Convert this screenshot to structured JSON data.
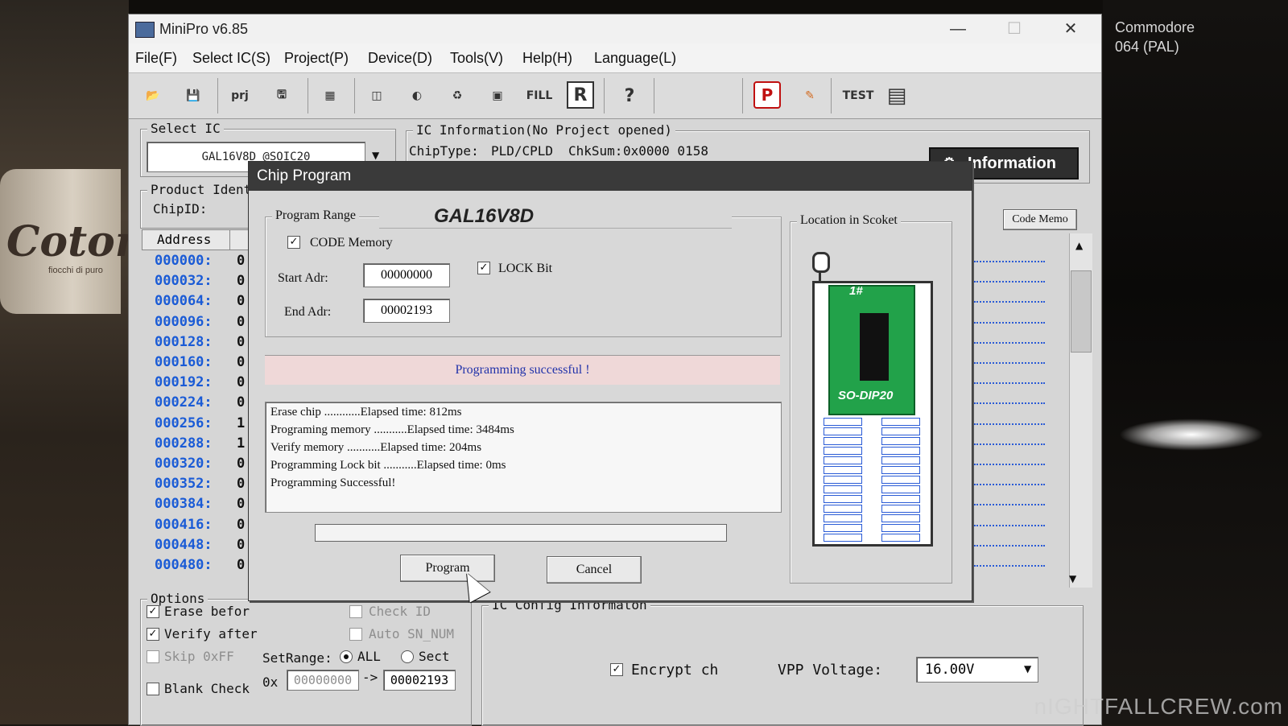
{
  "background": {
    "right_text_line1": "Commodore",
    "right_text_line2": "064 (PAL)",
    "cup_brand": "Cotone",
    "cup_sub": "fiocchi di puro",
    "watermark": "nIGHTFALLCREW.com"
  },
  "app": {
    "title": "MiniPro v6.85",
    "window_controls": [
      "—",
      "☐",
      "✕"
    ]
  },
  "menu": [
    "File(F)",
    "Select IC(S)",
    "Project(P)",
    "Device(D)",
    "Tools(V)",
    "Help(H)",
    "Language(L)"
  ],
  "toolbar": {
    "prj_label": "prj",
    "fill_label": "FILL",
    "r_label": "R",
    "help_label": "?",
    "p_label": "P",
    "test_label": "TEST"
  },
  "select_ic": {
    "label": "Select IC",
    "value": "GAL16V8D @SOIC20"
  },
  "ic_info": {
    "label": "IC Information(No Project opened)",
    "chip_type_label": "ChipType:",
    "chip_type": "PLD/CPLD",
    "checksum_label": "ChkSum:",
    "checksum": "0x0000 0158",
    "information_button": "Information"
  },
  "product_ident": {
    "label": "Product Identi",
    "chipid_label": "ChipID:"
  },
  "code_memo_tab": "Code Memo",
  "address_table": {
    "header": "Address",
    "rows": [
      {
        "addr": "000000:",
        "val": "0"
      },
      {
        "addr": "000032:",
        "val": "0"
      },
      {
        "addr": "000064:",
        "val": "0"
      },
      {
        "addr": "000096:",
        "val": "0"
      },
      {
        "addr": "000128:",
        "val": "0"
      },
      {
        "addr": "000160:",
        "val": "0"
      },
      {
        "addr": "000192:",
        "val": "0"
      },
      {
        "addr": "000224:",
        "val": "0"
      },
      {
        "addr": "000256:",
        "val": "1"
      },
      {
        "addr": "000288:",
        "val": "1"
      },
      {
        "addr": "000320:",
        "val": "0"
      },
      {
        "addr": "000352:",
        "val": "0"
      },
      {
        "addr": "000384:",
        "val": "0"
      },
      {
        "addr": "000416:",
        "val": "0"
      },
      {
        "addr": "000448:",
        "val": "0"
      },
      {
        "addr": "000480:",
        "val": "0"
      }
    ]
  },
  "options": {
    "label": "Options",
    "erase_before": "Erase befor",
    "verify_after": "Verify after",
    "skip_0xff": "Skip 0xFF",
    "blank_check": "Blank Check",
    "check_id": "Check ID",
    "auto_sn": "Auto SN_NUM",
    "set_range_label": "SetRange:",
    "range_all": "ALL",
    "range_sect": "Sect",
    "hex_prefix": "0x",
    "range_start": "00000000",
    "range_arrow": "->",
    "range_end": "00002193"
  },
  "ic_config": {
    "label": "IC Config Informaton",
    "encrypt_label": "Encrypt ch",
    "vpp_label": "VPP Voltage:",
    "vpp_value": "16.00V"
  },
  "dialog": {
    "title": "Chip Program",
    "program_range_label": "Program Range",
    "chip_name": "GAL16V8D",
    "code_memory_label": "CODE Memory",
    "start_label": "Start Adr:",
    "start_value": "00000000",
    "end_label": "End Adr:",
    "end_value": "00002193",
    "lock_bit_label": "LOCK Bit",
    "status": "Programming successful !",
    "log": [
      "Erase chip ............Elapsed time: 812ms",
      "Programing memory ...........Elapsed time: 3484ms",
      "Verify memory ...........Elapsed time: 204ms",
      "Programming Lock bit ...........Elapsed time: 0ms",
      "Programming Successful!"
    ],
    "socket_label": "Location in Scoket",
    "pin1_label": "1#",
    "package_label": "SO-DIP20",
    "program_button": "Program",
    "cancel_button": "Cancel"
  }
}
